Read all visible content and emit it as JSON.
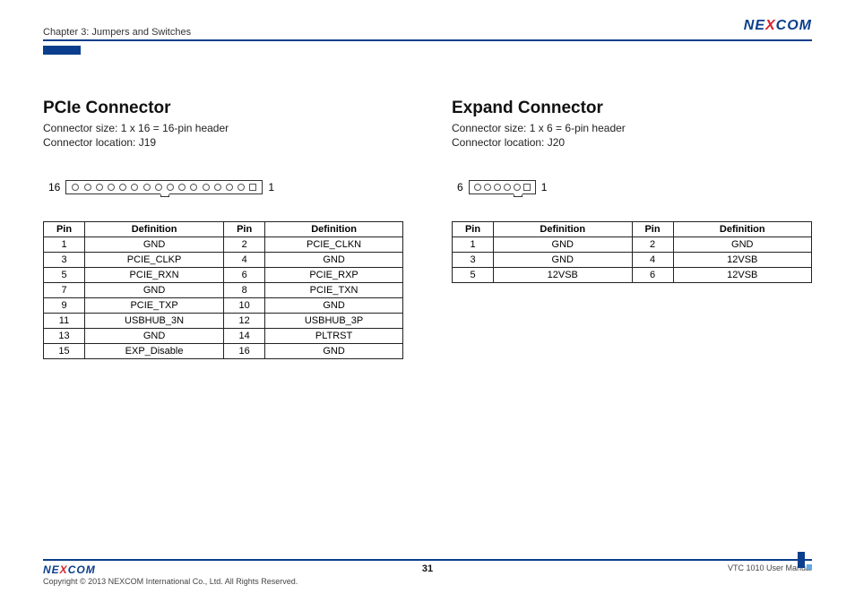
{
  "header": {
    "chapter": "Chapter 3: Jumpers and Switches"
  },
  "left": {
    "title": "PCIe Connector",
    "size": "Connector size: 1 x 16 = 16-pin header",
    "loc": "Connector location: J19",
    "lab_left": "16",
    "lab_right": "1",
    "table": {
      "h1": "Pin",
      "h2": "Definition",
      "h3": "Pin",
      "h4": "Definition",
      "rows": [
        {
          "a": "1",
          "b": "GND",
          "c": "2",
          "d": "PCIE_CLKN"
        },
        {
          "a": "3",
          "b": "PCIE_CLKP",
          "c": "4",
          "d": "GND"
        },
        {
          "a": "5",
          "b": "PCIE_RXN",
          "c": "6",
          "d": "PCIE_RXP"
        },
        {
          "a": "7",
          "b": "GND",
          "c": "8",
          "d": "PCIE_TXN"
        },
        {
          "a": "9",
          "b": "PCIE_TXP",
          "c": "10",
          "d": "GND"
        },
        {
          "a": "11",
          "b": "USBHUB_3N",
          "c": "12",
          "d": "USBHUB_3P"
        },
        {
          "a": "13",
          "b": "GND",
          "c": "14",
          "d": "PLTRST"
        },
        {
          "a": "15",
          "b": "EXP_Disable",
          "c": "16",
          "d": "GND"
        }
      ]
    }
  },
  "right": {
    "title": "Expand Connector",
    "size": "Connector size: 1 x 6 = 6-pin header",
    "loc": "Connector location: J20",
    "lab_left": "6",
    "lab_right": "1",
    "table": {
      "h1": "Pin",
      "h2": "Definition",
      "h3": "Pin",
      "h4": "Definition",
      "rows": [
        {
          "a": "1",
          "b": "GND",
          "c": "2",
          "d": "GND"
        },
        {
          "a": "3",
          "b": "GND",
          "c": "4",
          "d": "12VSB"
        },
        {
          "a": "5",
          "b": "12VSB",
          "c": "6",
          "d": "12VSB"
        }
      ]
    }
  },
  "footer": {
    "copyright": "Copyright © 2013 NEXCOM International Co., Ltd. All Rights Reserved.",
    "page": "31",
    "manual": "VTC 1010 User Manual"
  }
}
